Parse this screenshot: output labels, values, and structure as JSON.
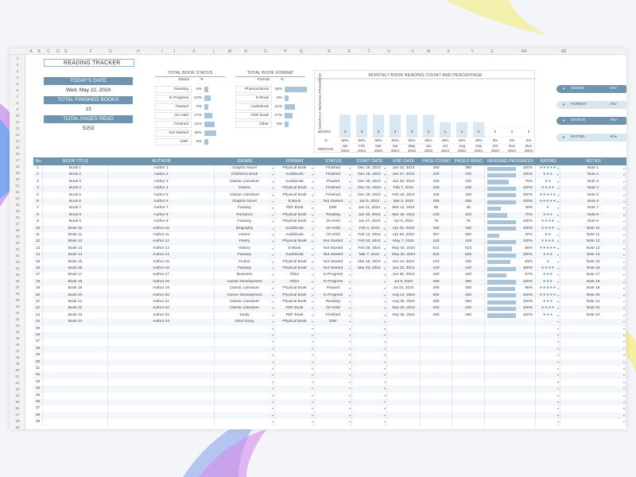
{
  "sheet": {
    "title": "READING TRACKER",
    "columns": [
      "A",
      "B",
      "C",
      "D",
      "E",
      "F",
      "G",
      "H",
      "I",
      "J",
      "K",
      "L",
      "M",
      "N",
      "O",
      "P",
      "Q",
      "R",
      "S",
      "T",
      "U",
      "V",
      "W",
      "X",
      "Y",
      "Z",
      "AA",
      "AB"
    ]
  },
  "kpis": {
    "today_label": "TODAY'S DATE",
    "today_value": "Wed, May 22, 2024",
    "finished_label": "TOTAL FINISHED BOOKS",
    "finished_value": "13",
    "pages_label": "TOTAL PAGES READ",
    "pages_value": "5153"
  },
  "status_summary": {
    "title": "TOTAL BOOK STATUS",
    "hdr_label": "Status",
    "hdr_pct": "%",
    "rows": [
      {
        "label": "Reading",
        "pct": "8%",
        "v": 8
      },
      {
        "label": "In Progress",
        "pct": "13%",
        "v": 13
      },
      {
        "label": "Paused",
        "pct": "8%",
        "v": 8
      },
      {
        "label": "On Hold",
        "pct": "17%",
        "v": 17
      },
      {
        "label": "Finished",
        "pct": "21%",
        "v": 21
      },
      {
        "label": "Not Started",
        "pct": "25%",
        "v": 25
      },
      {
        "label": "DNF",
        "pct": "8%",
        "v": 8
      }
    ]
  },
  "format_summary": {
    "title": "TOTAL BOOK FORMAT",
    "hdr_label": "Format",
    "hdr_pct": "%",
    "rows": [
      {
        "label": "Physical Book",
        "pct": "46%",
        "v": 46
      },
      {
        "label": "E-Book",
        "pct": "8%",
        "v": 8
      },
      {
        "label": "Audiobook",
        "pct": "21%",
        "v": 21
      },
      {
        "label": "PDF Book",
        "pct": "17%",
        "v": 17
      },
      {
        "label": "Other",
        "pct": "8%",
        "v": 8
      }
    ]
  },
  "chart_data": {
    "type": "bar",
    "title": "MONTHLY BOOK READING COUNT AND PERCENTAGE",
    "ylabel": "MONTHLY READING PROGRESS",
    "row_books_label": "BOOKS",
    "row_pct_label": "%",
    "row_month_label": "MONTHS",
    "categories": [
      "Jan 2024",
      "Feb 2024",
      "Mar 2024",
      "Apr 2024",
      "May 2024",
      "Jun 2024",
      "Jul 2024",
      "Aug 2024",
      "Sep 2024",
      "Oct 2024",
      "Nov 2024",
      "Dec 2024"
    ],
    "books": [
      "3",
      "3",
      "3",
      "3",
      "3",
      "3",
      "2",
      "2",
      "2",
      "0",
      "0",
      "0"
    ],
    "pct": [
      "60%",
      "60%",
      "60%",
      "60%",
      "60%",
      "60%",
      "40%",
      "40%",
      "40%",
      "0%",
      "0%",
      "0%"
    ],
    "values": [
      60,
      60,
      60,
      60,
      60,
      60,
      40,
      40,
      40,
      0,
      0,
      0
    ],
    "ylim": [
      0,
      100
    ]
  },
  "filters": [
    {
      "name": "GENRE",
      "value": "All",
      "dark": true
    },
    {
      "name": "FORMAT",
      "value": "All",
      "dark": false
    },
    {
      "name": "STATUS",
      "value": "All",
      "dark": true
    },
    {
      "name": "RATING",
      "value": "All",
      "dark": false
    }
  ],
  "table": {
    "headers": [
      "No",
      "BOOK TITLE",
      "AUTHOR",
      "GENRE",
      "FORMAT",
      "STATUS",
      "START DATE",
      "END DATE",
      "PAGE COUNT",
      "PAGES READ",
      "READING PROGRESS",
      "RATING",
      "NOTES"
    ],
    "rows": [
      [
        "1",
        "Book 1",
        "Author 1",
        "Graphic Novel",
        "Physical Book",
        "Finished",
        "Dec 15, 2023",
        "Jan 10, 2024",
        "380",
        "380",
        "100%",
        "★★★★★",
        "Note 1"
      ],
      [
        "2",
        "Book 2",
        "Author 2",
        "Children's Book",
        "Audiobook",
        "Finished",
        "Dec 15, 2023",
        "Jan 27, 2024",
        "240",
        "240",
        "100%",
        "★★★",
        "Note 2"
      ],
      [
        "3",
        "Book 3",
        "Author 3",
        "Classic Literature",
        "Audiobook",
        "Paused",
        "Dec 20, 2023",
        "Jan 20, 2024",
        "159",
        "120",
        "75%",
        "★★",
        "Note 3"
      ],
      [
        "4",
        "Book 4",
        "Author 4",
        "Drama",
        "Physical Book",
        "Finished",
        "Dec 24, 2023",
        "Feb 7, 2024",
        "248",
        "248",
        "100%",
        "★★★★",
        "Note 4"
      ],
      [
        "5",
        "Book 5",
        "Author 5",
        "Classic Literature",
        "Physical Book",
        "Finished",
        "Dec 26, 2023",
        "Feb 15, 2024",
        "159",
        "159",
        "100%",
        "★★★★★",
        "Note 5"
      ],
      [
        "6",
        "Book 6",
        "Author 6",
        "Graphic Novel",
        "E-Book",
        "Not Started",
        "Jan 5, 2024",
        "Mar 8, 2024",
        "258",
        "258",
        "100%",
        "★★★★★",
        "Note 6"
      ],
      [
        "7",
        "Book 7",
        "Author 7",
        "Fantasy",
        "PDF Book",
        "DNF",
        "Jan 11, 2024",
        "Mar 13, 2024",
        "95",
        "46",
        "48%",
        "★",
        "Note 7"
      ],
      [
        "8",
        "Book 8",
        "Author 8",
        "Romance",
        "Physical Book",
        "Reading",
        "Jan 19, 2024",
        "Mar 26, 2024",
        "145",
        "102",
        "70%",
        "★★★",
        "Note 8"
      ],
      [
        "9",
        "Book 9",
        "Author 9",
        "Fantasy",
        "Physical Book",
        "On Hold",
        "Jan 27, 2024",
        "Apr 5, 2024",
        "78",
        "78",
        "100%",
        "★★★★",
        "Note 9"
      ],
      [
        "10",
        "Book 10",
        "Author 10",
        "Biography",
        "Audiobook",
        "On Hold",
        "Feb 4, 2024",
        "Apr 25, 2024",
        "156",
        "156",
        "100%",
        "★★★★",
        "Note 10"
      ],
      [
        "11",
        "Book 11",
        "Author 11",
        "Humor",
        "Audiobook",
        "On Hold",
        "Feb 12, 2024",
        "Apr 26, 2024",
        "357",
        "150",
        "42%",
        "★★",
        "Note 11"
      ],
      [
        "12",
        "Book 12",
        "Author 12",
        "Poetry",
        "Physical Book",
        "Not Started",
        "Feb 20, 2024",
        "May 7, 2024",
        "248",
        "248",
        "100%",
        "★★★★",
        "Note 12"
      ],
      [
        "13",
        "Book 13",
        "Author 13",
        "History",
        "E-Book",
        "Not Started",
        "Feb 28, 2024",
        "May 15, 2024",
        "614",
        "523",
        "85%",
        "★★★★★",
        "Note 13"
      ],
      [
        "14",
        "Book 14",
        "Author 14",
        "Fantasy",
        "Audiobook",
        "Not Started",
        "Mar 7, 2024",
        "May 30, 2024",
        "526",
        "526",
        "100%",
        "★★★",
        "Note 14"
      ],
      [
        "15",
        "Book 15",
        "Author 15",
        "Fiction",
        "Physical Book",
        "Not Started",
        "Mar 15, 2024",
        "Jun 14, 2024",
        "123",
        "100",
        "81%",
        "★",
        "Note 15"
      ],
      [
        "16",
        "Book 16",
        "Author 16",
        "Fantasy",
        "Physical Book",
        "Not Started",
        "Mar 23, 2024",
        "Jun 23, 2024",
        "140",
        "140",
        "100%",
        "★★★★",
        "Note 16"
      ],
      [
        "17",
        "Book 17",
        "Author 17",
        "Business",
        "Other",
        "In Progress",
        "",
        "Jun 30, 2024",
        "150",
        "100",
        "67%",
        "★★★",
        "Note 17"
      ],
      [
        "18",
        "Book 18",
        "Author 18",
        "Career Development",
        "Other",
        "In Progress",
        "",
        "Jul 9, 2024",
        "180",
        "180",
        "100%",
        "★★★",
        "Note 18"
      ],
      [
        "19",
        "Book 19",
        "Author 19",
        "Classic Literature",
        "Physical Book",
        "Paused",
        "",
        "Jul 24, 2024",
        "295",
        "295",
        "98%",
        "★★★★★",
        "Note 19"
      ],
      [
        "20",
        "Book 20",
        "Author 20",
        "Career Development",
        "Physical Book",
        "In Progress",
        "",
        "Aug 14, 2024",
        "260",
        "260",
        "100%",
        "★★★★★",
        "Note 20"
      ],
      [
        "21",
        "Book 21",
        "Author 21",
        "Classic Literature",
        "Physical Book",
        "Reading",
        "",
        "Aug 30, 2024",
        "280",
        "280",
        "100%",
        "★★★",
        "Note 21"
      ],
      [
        "22",
        "Book 22",
        "Author 22",
        "Classic Literature",
        "PDF Book",
        "On Hold",
        "",
        "Sep 20, 2024",
        "232",
        "232",
        "100%",
        "★★★★",
        "Note 22"
      ],
      [
        "23",
        "Book 23",
        "Author 23",
        "Study",
        "PDF Book",
        "Finished",
        "",
        "Sep 30, 2024",
        "280",
        "280",
        "100%",
        "★★★",
        "Note 23"
      ],
      [
        "24",
        "Book 24",
        "Author 24",
        "Short Story",
        "Physical Book",
        "DNF",
        "",
        "",
        "",
        "",
        "",
        "",
        ""
      ]
    ],
    "empty_numbers": [
      "25",
      "26",
      "27",
      "28",
      "29",
      "30",
      "31",
      "32",
      "33",
      "34",
      "35",
      "36",
      "37",
      "38",
      "39"
    ]
  },
  "colors": {
    "accent": "#6f94ad",
    "bar": "#a9c4d8",
    "header_text": "#ffffff"
  }
}
